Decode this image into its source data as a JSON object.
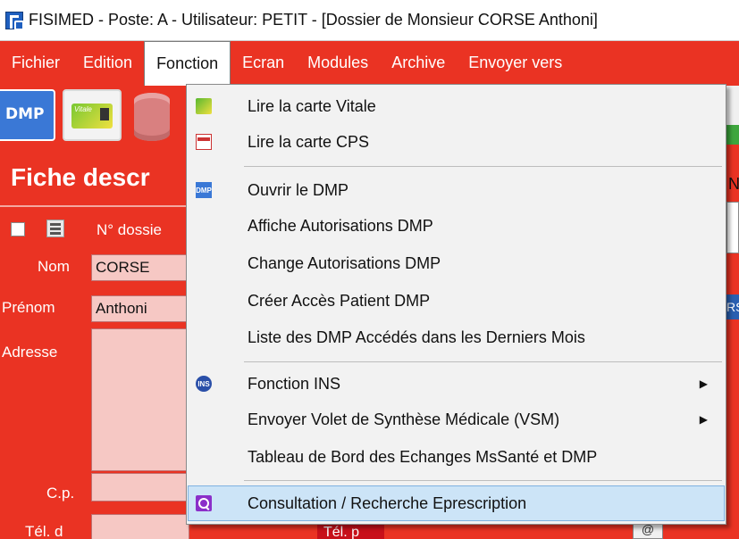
{
  "window": {
    "title": "FISIMED - Poste: A - Utilisateur: PETIT - [Dossier de Monsieur CORSE Anthoni]"
  },
  "menubar": {
    "items": [
      {
        "label": "Fichier"
      },
      {
        "label": "Edition"
      },
      {
        "label": "Fonction"
      },
      {
        "label": "Ecran"
      },
      {
        "label": "Modules"
      },
      {
        "label": "Archive"
      },
      {
        "label": "Envoyer vers"
      }
    ]
  },
  "toolbar": {
    "dmp_label": "DMP",
    "vitale_label": "Vitale"
  },
  "form": {
    "title": "Fiche descr",
    "dossier_label": "N° dossie",
    "nom_label": "Nom",
    "nom_value": "CORSE",
    "prenom_label": "Prénom",
    "prenom_value": "Anthoni",
    "adresse_label": "Adresse",
    "cp_label": "C.p.",
    "teld_label": "Tél. d",
    "teln_label": "Tél. p",
    "right_n": "N",
    "right_rs": "RS",
    "at_symbol": "@"
  },
  "menu": {
    "items": [
      {
        "label": "Lire la carte Vitale",
        "icon": "vitale-card-icon"
      },
      {
        "label": "Lire la carte CPS",
        "icon": "cps-card-icon"
      },
      {
        "label": "Ouvrir le DMP",
        "icon": "dmp-icon"
      },
      {
        "label": "Affiche Autorisations DMP"
      },
      {
        "label": "Change Autorisations DMP"
      },
      {
        "label": "Créer Accès Patient DMP"
      },
      {
        "label": "Liste des DMP Accédés dans les Derniers Mois"
      },
      {
        "label": "Fonction INS",
        "icon": "ins-icon",
        "submenu": true
      },
      {
        "label": "Envoyer Volet de Synthèse Médicale (VSM)",
        "submenu": true
      },
      {
        "label": "Tableau de Bord des Echanges MsSanté et DMP"
      },
      {
        "label": "Consultation / Recherche Eprescription",
        "icon": "search-icon",
        "highlighted": true
      }
    ],
    "dmp_icon_text": "DMP",
    "ins_icon_text": "INS",
    "arrow": "▶"
  },
  "colors": {
    "background_red": "#ea3323",
    "menu_background": "#f2f2f2",
    "highlight": "#cce4f7"
  }
}
